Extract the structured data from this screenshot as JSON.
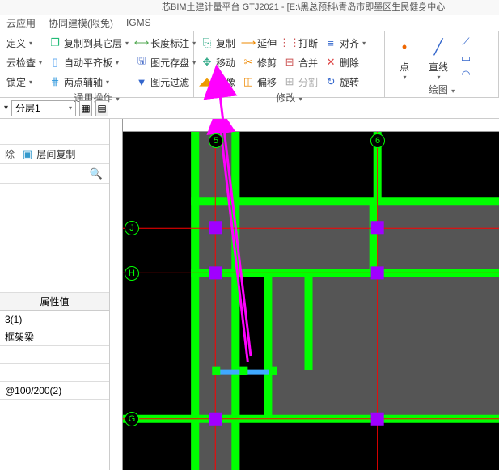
{
  "title": "芯BIM土建计量平台 GTJ2021 - [E:\\黑总预科\\青岛市即墨区生民健身中心",
  "menu": {
    "cloud_app": "云应用",
    "collab": "协同建模(限免)",
    "igms": "IGMS"
  },
  "ribbon": {
    "group1": {
      "define": "定义",
      "cloud_check": "云检查",
      "lock": "锁定",
      "copy_layer": "复制到其它层",
      "auto_align": "自动平齐板",
      "two_point": "两点辅轴",
      "len_annot": "长度标注",
      "save_element": "图元存盘",
      "filter": "图元过滤",
      "footer": "通用操作"
    },
    "group2": {
      "copy": "复制",
      "move": "移动",
      "mirror": "镜像",
      "extend": "延伸",
      "trim": "修剪",
      "offset": "偏移",
      "break": "打断",
      "merge": "合并",
      "split": "分割",
      "align": "对齐",
      "delete": "删除",
      "rotate": "旋转",
      "footer": "修改"
    },
    "group3": {
      "point": "点",
      "line": "直线",
      "footer": "绘图"
    }
  },
  "layer_select": "分层1",
  "left": {
    "del": "除",
    "layer_copy": "层间复制",
    "props_header": "属性值",
    "rows": [
      "3(1)",
      "框架梁",
      "",
      "",
      "@100/200(2)"
    ]
  },
  "axes": {
    "top": [
      "5",
      "6"
    ],
    "left": [
      "J",
      "H",
      "G"
    ]
  }
}
